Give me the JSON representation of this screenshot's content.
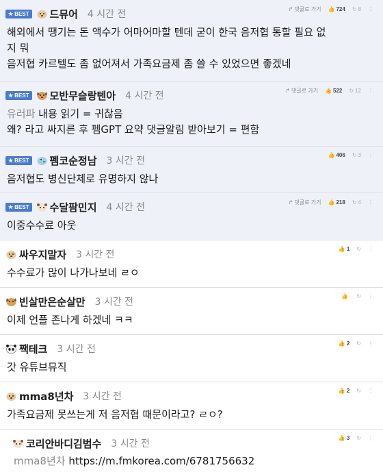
{
  "best_label": "BEST",
  "comments": [
    {
      "nick": "드뮤어",
      "time": "4 시간 전",
      "reply_btn": "댓글로 가기",
      "likes": "724",
      "replies": "8",
      "lines": [
        "해외에서 땡기는 돈 액수가 어마어마할 텐데 굳이 한국 음저협 통할 필요 없",
        "지 뭐",
        "음저협 카르텔도 좀 없어져서 가족요금제 좀 쓸 수 있었으면 좋겠네"
      ]
    },
    {
      "nick": "모반무슬랑텐아",
      "time": "4 시간 전",
      "reply_btn": "댓글로 가기",
      "likes": "522",
      "replies": "12",
      "quote": "유러파",
      "lines": [
        " 내용 읽기 = 귀찮음",
        "왜? 라고 싸지른 후 펨GPT 요약 댓글알림 받아보기 = 편함"
      ]
    },
    {
      "nick": "펨코순정남",
      "time": "3 시간 전",
      "reply_btn": "",
      "likes": "406",
      "replies": "3",
      "lines": [
        "음저협도 병신단체로 유명하지 않나"
      ]
    },
    {
      "nick": "수달팜민지",
      "time": "4 시간 전",
      "reply_btn": "댓글로 가기",
      "likes": "218",
      "replies": "4",
      "lines": [
        "이중수수료 아웃"
      ]
    },
    {
      "nick": "싸우지말자",
      "time": "3 시간 전",
      "likes": "1",
      "lines": [
        "수수료가 많이 나가나보네 ㄹㅇ"
      ]
    },
    {
      "nick": "빈살만은순살만",
      "time": "3 시간 전",
      "likes": "",
      "lines": [
        "이제 언플 존나게 하겠네 ㅋㅋ"
      ]
    },
    {
      "nick": "짹테크",
      "time": "3 시간 전",
      "likes": "2",
      "lines": [
        "갓 유튜브뮤직"
      ]
    },
    {
      "nick": "mma8년차",
      "time": "3 시간 전",
      "likes": "2",
      "lines": [
        "가족요금제 못쓰는게 저 음저협 때문이라고? ㄹㅇ?"
      ]
    },
    {
      "nick": "코리안바디김범수",
      "time": "3 시간 전",
      "likes": "3",
      "quote": "mma8년차",
      "lines": [
        " https://m.fmkorea.com/6781756632"
      ]
    }
  ]
}
